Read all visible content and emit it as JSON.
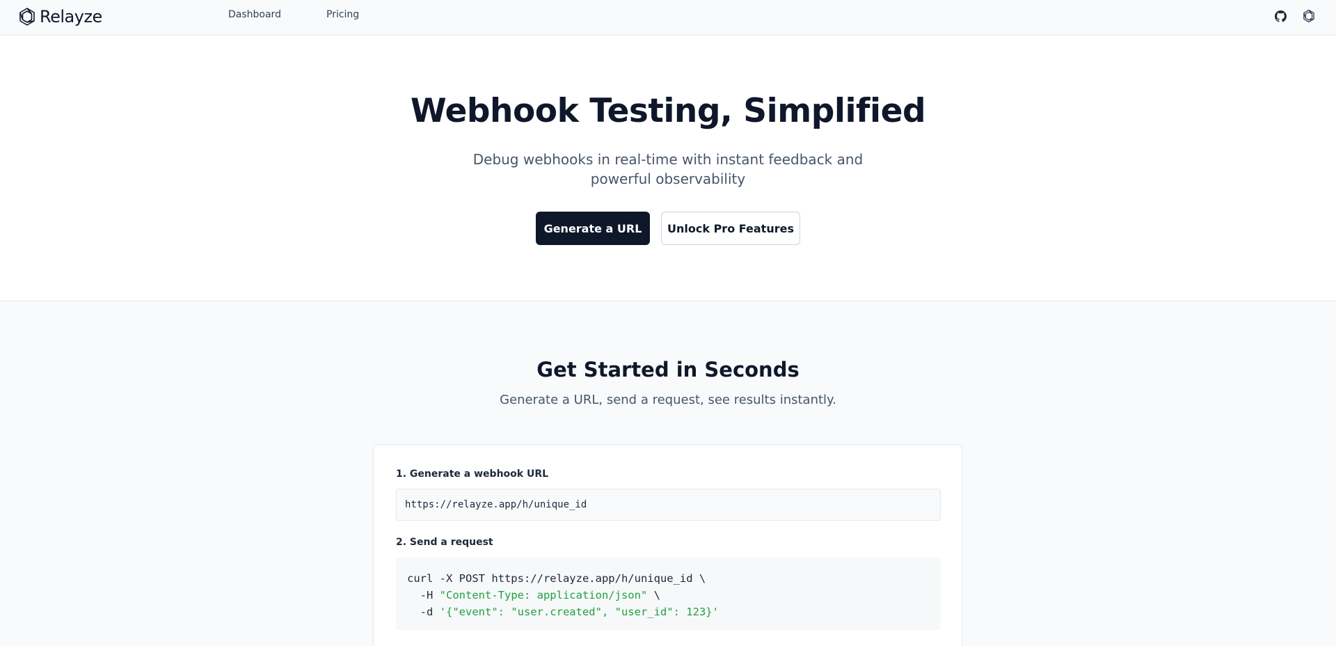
{
  "nav": {
    "brand": "Relayze",
    "links": [
      {
        "label": "Dashboard"
      },
      {
        "label": "Pricing"
      }
    ],
    "icons": [
      "github-icon",
      "theme-icon"
    ]
  },
  "hero": {
    "title": "Webhook Testing, Simplified",
    "subtitle": "Debug webhooks in real-time with instant feedback and powerful observability",
    "primary_button": "Generate a URL",
    "secondary_button": "Unlock Pro Features"
  },
  "get_started": {
    "title": "Get Started in Seconds",
    "subtitle": "Generate a URL, send a request, see results instantly.",
    "step1_label": "1. Generate a webhook URL",
    "url_value": "https://relayze.app/h/unique_id",
    "step2_label": "2. Send a request",
    "code": {
      "line1": "curl -X POST https://relayze.app/h/unique_id \\",
      "line2_prefix": "  -H ",
      "line2_string": "\"Content-Type: application/json\"",
      "line2_suffix": " \\",
      "line3_prefix": "  -d ",
      "line3_string": "'{\"event\": \"user.created\", \"user_id\": 123}'"
    }
  },
  "colors": {
    "primary": "#0f172a",
    "code_string": "#22a041",
    "muted_text": "#475569",
    "section_bg": "#f8fafc"
  }
}
